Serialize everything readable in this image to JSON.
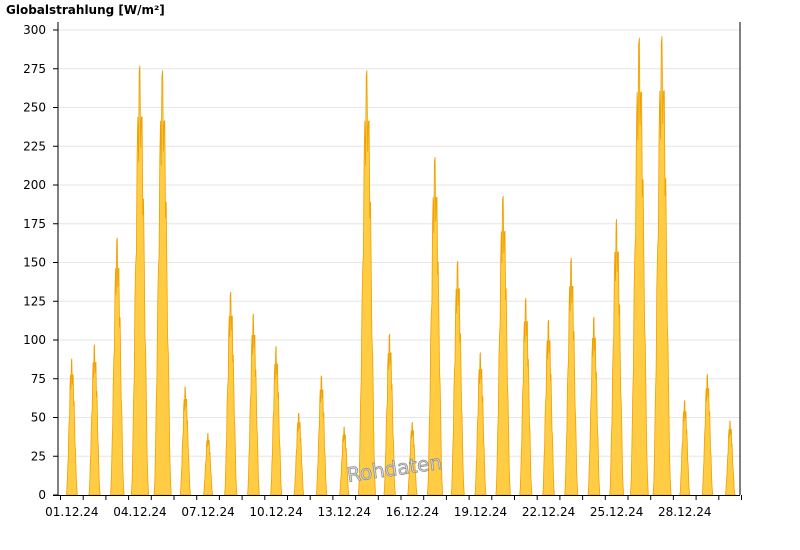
{
  "chart_data": {
    "type": "area",
    "title": "",
    "ylabel": "Globalstrahlung [W/m²]",
    "xlabel": "",
    "ylim": [
      0,
      300
    ],
    "yticks": [
      0,
      25,
      50,
      75,
      100,
      125,
      150,
      175,
      200,
      225,
      250,
      275,
      300
    ],
    "grid": "horizontal",
    "xticklabels": [
      "01.12.24",
      "04.12.24",
      "07.12.24",
      "10.12.24",
      "13.12.24",
      "16.12.24",
      "19.12.24",
      "22.12.24",
      "25.12.24",
      "28.12.24"
    ],
    "watermark": "Rohdaten",
    "series": [
      {
        "x": [
          "01.12.24",
          "02.12.24",
          "03.12.24",
          "04.12.24",
          "05.12.24",
          "06.12.24",
          "07.12.24",
          "08.12.24",
          "09.12.24",
          "10.12.24",
          "11.12.24",
          "12.12.24",
          "13.12.24",
          "14.12.24",
          "15.12.24",
          "16.12.24",
          "17.12.24",
          "18.12.24",
          "19.12.24",
          "20.12.24",
          "21.12.24",
          "22.12.24",
          "23.12.24",
          "24.12.24",
          "25.12.24",
          "26.12.24",
          "27.12.24",
          "28.12.24",
          "29.12.24",
          "30.12.24",
          "31.12.24"
        ],
        "daily_peak": [
          88,
          97,
          166,
          277,
          274,
          70,
          40,
          131,
          117,
          96,
          53,
          77,
          44,
          274,
          104,
          47,
          218,
          151,
          92,
          193,
          127,
          113,
          153,
          115,
          178,
          295,
          296,
          61,
          78,
          48,
          0
        ],
        "color": "#ffcc44",
        "stroke": "#f0a000"
      }
    ]
  }
}
